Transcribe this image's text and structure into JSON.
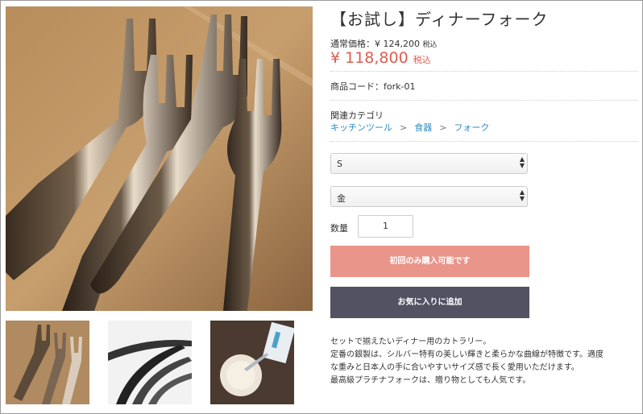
{
  "product": {
    "title": "【お試し】ディナーフォーク",
    "regular_price_label": "通常価格：",
    "regular_price": "¥ 124,200",
    "regular_tax": "税込",
    "price": "¥ 118,800",
    "price_tax": "税込",
    "code_label": "商品コード：",
    "code": "fork-01",
    "category_label": "関連カテゴリ",
    "categories": [
      "キッチンツール",
      "食器",
      "フォーク"
    ],
    "category_separator": ">"
  },
  "options": {
    "size": {
      "selected": "S"
    },
    "color": {
      "selected": "金"
    }
  },
  "quantity": {
    "label": "数量",
    "value": "1"
  },
  "buttons": {
    "buy": "初回のみ購入可能です",
    "favorite": "お気に入りに追加"
  },
  "description": [
    "セットで揃えたいディナー用のカトラリー。",
    "定番の銀製は、シルバー特有の美しい輝きと柔らかな曲線が特徴です。適度",
    "な重みと日本人の手に合いやすいサイズ感で長く愛用いただけます。",
    "最高級プラチナフォークは、贈り物としても人気です。"
  ],
  "images": {
    "main": "dinner-forks-photo",
    "thumbs": [
      "dinner-forks-thumb",
      "silver-fork-tines-thumb",
      "plate-and-fork-on-table-thumb"
    ]
  },
  "colors": {
    "price": "#de5d50",
    "link": "#2e8bbf",
    "buy_button": "#e9958a",
    "favorite_button": "#525263"
  }
}
